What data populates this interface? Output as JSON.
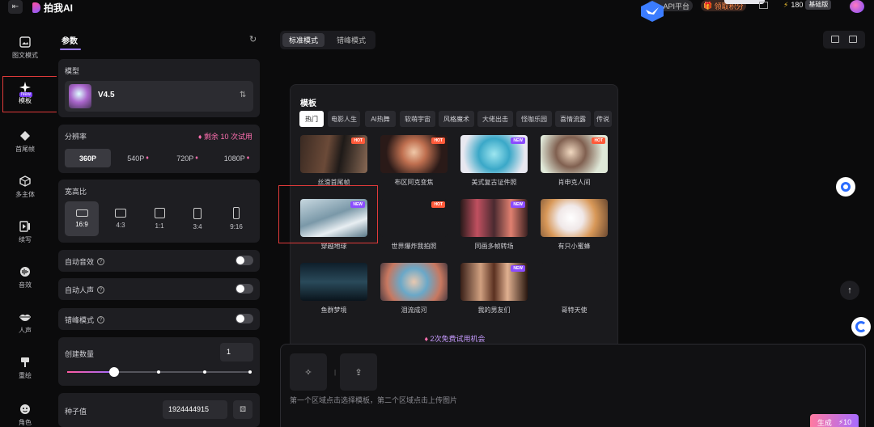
{
  "header": {
    "logo": "拍我AI",
    "api_label": "API平台",
    "gift_label": "领取积分",
    "points": "180",
    "level": "基础版"
  },
  "nav": {
    "items": [
      {
        "label": "图文模式",
        "icon": "image-icon"
      },
      {
        "label": "模板",
        "icon": "sparkle-icon"
      },
      {
        "label": "首尾帧",
        "icon": "diamond-frame-icon",
        "badge": "New"
      },
      {
        "label": "多主体",
        "icon": "cube-icon"
      },
      {
        "label": "续写",
        "icon": "continue-icon"
      },
      {
        "label": "音效",
        "icon": "audio-icon"
      },
      {
        "label": "人声",
        "icon": "lips-icon"
      },
      {
        "label": "重绘",
        "icon": "brush-icon"
      },
      {
        "label": "角色",
        "icon": "face-icon"
      }
    ]
  },
  "params": {
    "tab": "参数",
    "model": {
      "label": "模型",
      "name": "V4.5"
    },
    "resolution": {
      "label": "分辨率",
      "trial": "剩余 10 次试用",
      "options": [
        "360P",
        "540P",
        "720P",
        "1080P"
      ]
    },
    "aspect": {
      "label": "宽高比",
      "options": [
        "16:9",
        "4:3",
        "1:1",
        "3:4",
        "9:16"
      ]
    },
    "auto_sfx": "自动音效",
    "auto_voice": "自动人声",
    "peak_mode": "错峰模式",
    "count": {
      "label": "创建数量",
      "value": "1"
    },
    "seed": {
      "label": "种子值",
      "value": "1924444915"
    }
  },
  "modes": {
    "standard": "标准模式",
    "offpeak": "错峰模式"
  },
  "templates": {
    "title": "模板",
    "categories": [
      "热门",
      "电影人生",
      "AI热舞",
      "软萌宇宙",
      "风格魔术",
      "大佬出击",
      "怪咖乐园",
      "喜情流露",
      "传说"
    ],
    "items": [
      {
        "name": "丝滑首尾帧",
        "badge": "HOT"
      },
      {
        "name": "布区阿克变焦",
        "badge": "HOT"
      },
      {
        "name": "美式复古证件照",
        "badge": "NEW"
      },
      {
        "name": "肖申克人间",
        "badge": "HOT"
      },
      {
        "name": "穿越地球",
        "badge": "NEW"
      },
      {
        "name": "世界爆炸我拍照",
        "badge": "HOT"
      },
      {
        "name": "同画多帧转场",
        "badge": "NEW"
      },
      {
        "name": "有只小蜜蜂",
        "badge": ""
      },
      {
        "name": "鱼群梦境",
        "badge": ""
      },
      {
        "name": "泪流成河",
        "badge": ""
      },
      {
        "name": "我的男友们",
        "badge": "NEW"
      },
      {
        "name": "哥特天使",
        "badge": ""
      }
    ],
    "free_trial": "2次免费试用机会"
  },
  "prompt": {
    "hint": "第一个区域点击选择模板，第二个区域点击上传图片",
    "generate": "生成",
    "cost": "10"
  }
}
